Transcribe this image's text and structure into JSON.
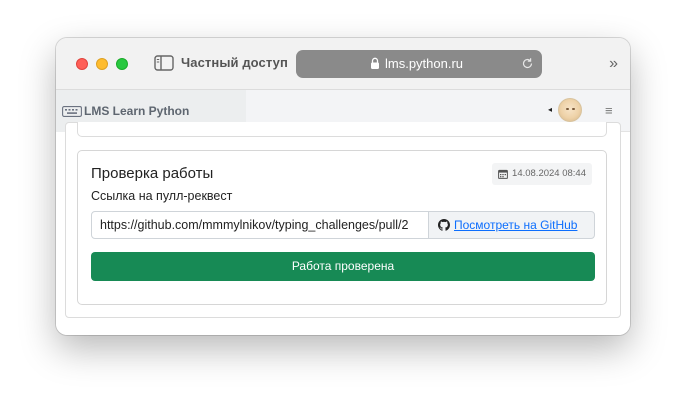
{
  "browser": {
    "private_label": "Частный доступ",
    "url": "lms.python.ru",
    "tab_title": "LMS Learn Python",
    "icons": {
      "sidebar": "sidebar-icon",
      "lock": "lock-icon",
      "reload": "reload-icon",
      "more": "chevron-double-right-icon",
      "tab": "keyboard-icon",
      "menu": "hamburger-menu-icon"
    },
    "more_glyph": "»",
    "menu_glyph": "≡",
    "caret_glyph": "◂"
  },
  "review": {
    "title": "Проверка работы",
    "date": "14.08.2024 08:44",
    "pr_label": "Ссылка на пулл-реквест",
    "pr_url": "https://github.com/mmmylnikov/typing_challenges/pull/2",
    "github_link": "Посмотреть на GitHub",
    "checked_button": "Работа проверена",
    "accent_color": "#178a55",
    "link_color": "#0d6efd"
  }
}
